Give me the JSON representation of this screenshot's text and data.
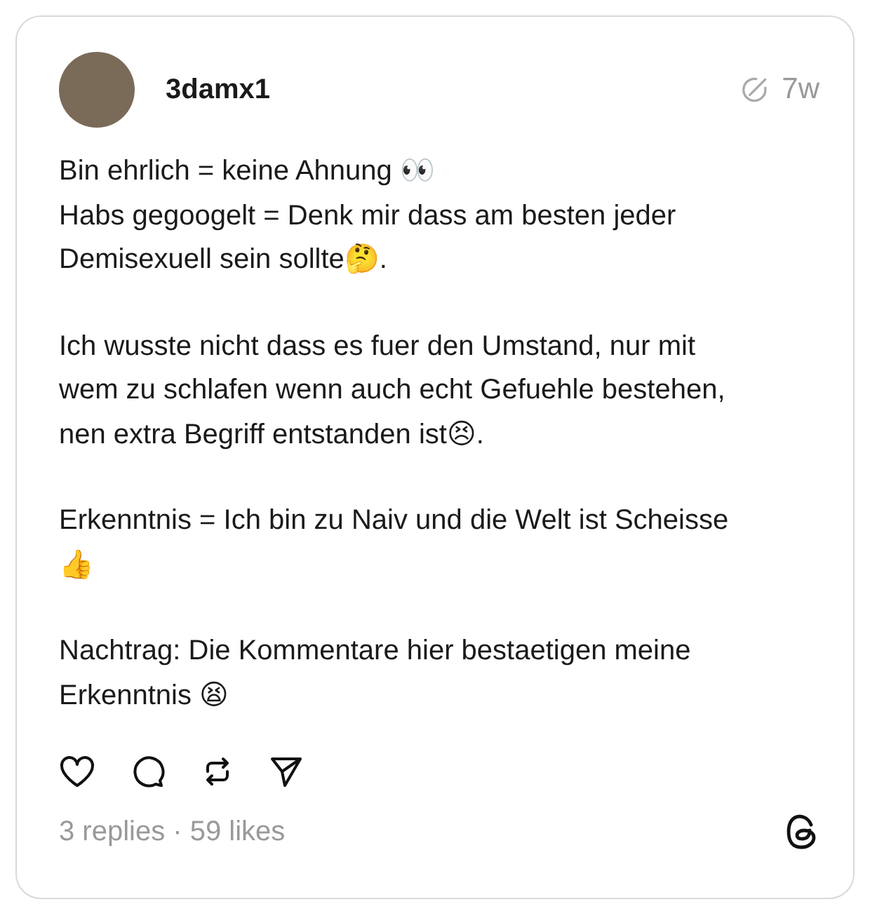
{
  "post": {
    "author": "3damx1",
    "time": "7w",
    "paragraphs": [
      [
        "Bin ehrlich = keine Ahnung 👀",
        "Habs gegoogelt = Denk mir dass am besten jeder",
        "Demisexuell sein sollte🤔."
      ],
      [
        "Ich wusste nicht dass es fuer den Umstand, nur mit",
        "wem zu schlafen wenn auch echt Gefuehle bestehen,",
        "nen extra Begriff entstanden ist😣."
      ],
      [
        "Erkenntnis = Ich bin zu Naiv und die Welt ist Scheisse",
        "👍"
      ],
      [
        "Nachtrag: Die Kommentare hier bestaetigen meine",
        "Erkenntnis 😫"
      ]
    ],
    "stats": "3 replies · 59 likes"
  }
}
